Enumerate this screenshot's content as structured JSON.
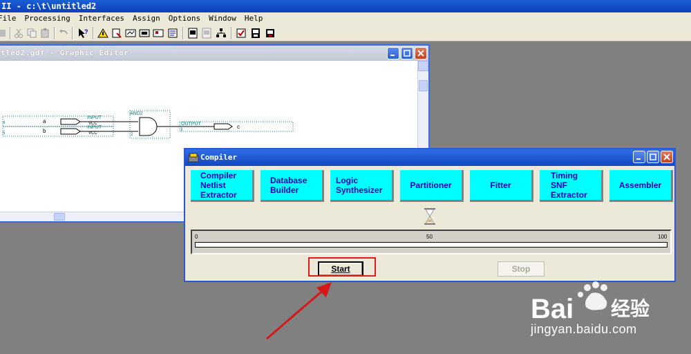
{
  "app": {
    "title": "II - c:\\t\\untitled2"
  },
  "menubar": [
    {
      "label": "File"
    },
    {
      "label": "Processing"
    },
    {
      "label": "Interfaces"
    },
    {
      "label": "Assign"
    },
    {
      "label": "Options"
    },
    {
      "label": "Window"
    },
    {
      "label": "Help"
    }
  ],
  "editor": {
    "title": "tled2.gdf - Graphic Editor",
    "schematic": {
      "input_a_name": "a",
      "input_b_name": "b",
      "input_label": "INPUT",
      "vcc_label": "VCC",
      "gate_label": "AND2",
      "output_label": "OUTPUT",
      "output_name": "c",
      "pin_4": "4",
      "pin_5": "5",
      "pin_2": "2",
      "pin_3": "3"
    }
  },
  "compiler": {
    "title": "Compiler",
    "modules": [
      {
        "lines": [
          "Compiler",
          "Netlist",
          "Extractor"
        ]
      },
      {
        "lines": [
          "Database",
          "Builder"
        ]
      },
      {
        "lines": [
          "Logic",
          "Synthesizer"
        ]
      },
      {
        "lines": [
          "Partitioner"
        ]
      },
      {
        "lines": [
          "Fitter"
        ]
      },
      {
        "lines": [
          "Timing",
          "SNF",
          "Extractor"
        ]
      },
      {
        "lines": [
          "Assembler"
        ]
      }
    ],
    "progress": {
      "value": 0,
      "tick_min": "0",
      "tick_mid": "50",
      "tick_max": "100"
    },
    "start_label": "Start",
    "stop_label": "Stop"
  },
  "watermark": {
    "brand": "Bai",
    "brand2": "经验",
    "url": "jingyan.baidu.com"
  },
  "colors": {
    "module_bg": "#00ffff",
    "module_text": "#0000c0",
    "highlight": "#e21a1a",
    "titlebar": "#1a5fd6"
  }
}
